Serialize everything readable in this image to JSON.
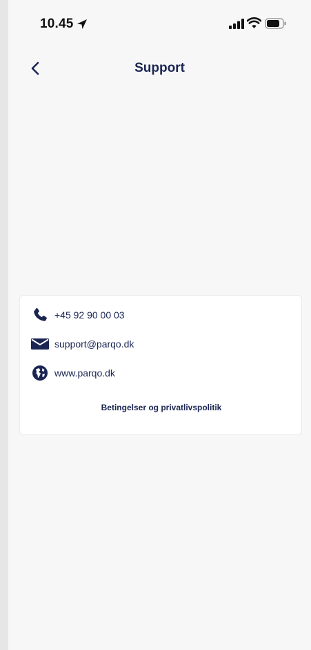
{
  "status_bar": {
    "time": "10.45",
    "icons": [
      "location-arrow-icon",
      "signal-icon",
      "wifi-icon",
      "battery-icon"
    ]
  },
  "nav": {
    "back_icon": "chevron-left-icon",
    "title": "Support"
  },
  "contact": {
    "phone": {
      "icon": "phone-icon",
      "label": "+45 92 90 00 03"
    },
    "email": {
      "icon": "envelope-icon",
      "label": "support@parqo.dk"
    },
    "website": {
      "icon": "globe-icon",
      "label": "www.parqo.dk"
    },
    "terms_link": "Betingelser og privatlivspolitik"
  },
  "colors": {
    "primary_text": "#1a2552",
    "background": "#f7f7f7",
    "card": "#ffffff"
  }
}
